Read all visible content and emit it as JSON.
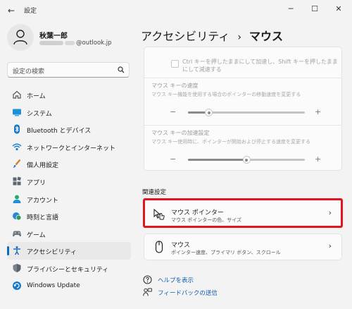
{
  "window": {
    "title": "設定",
    "back_glyph": "←",
    "minimize_glyph": "─",
    "maximize_glyph": "☐",
    "close_glyph": "✕"
  },
  "user": {
    "name": "秋葉一郎",
    "email_suffix": "@outlook.jp"
  },
  "search": {
    "placeholder": "設定の検索",
    "icon": "search-icon"
  },
  "nav": {
    "accent_color": "#0f6cbd",
    "items": [
      {
        "label": "ホーム",
        "icon": "home-icon"
      },
      {
        "label": "システム",
        "icon": "system-icon"
      },
      {
        "label": "Bluetooth とデバイス",
        "icon": "bluetooth-icon"
      },
      {
        "label": "ネットワークとインターネット",
        "icon": "network-icon"
      },
      {
        "label": "個人用設定",
        "icon": "brush-icon"
      },
      {
        "label": "アプリ",
        "icon": "apps-icon"
      },
      {
        "label": "アカウント",
        "icon": "account-icon"
      },
      {
        "label": "時刻と言語",
        "icon": "clock-globe-icon"
      },
      {
        "label": "ゲーム",
        "icon": "gamepad-icon"
      },
      {
        "label": "アクセシビリティ",
        "icon": "accessibility-icon",
        "active": true
      },
      {
        "label": "プライバシーとセキュリティ",
        "icon": "shield-icon"
      },
      {
        "label": "Windows Update",
        "icon": "update-icon"
      }
    ]
  },
  "breadcrumb": {
    "parent": "アクセシビリティ",
    "separator": "›",
    "current": "マウス"
  },
  "mouse_keys": {
    "checkbox_label": "Ctrl キーを押したままにして加速し、Shift キーを押したままにして減速する",
    "speed": {
      "title": "マウス キーの速度",
      "description": "マウス キー機能を使用する場合のポインターの移動速度を変更する",
      "minus": "−",
      "plus": "+",
      "value": 0.18
    },
    "acceleration": {
      "title": "マウス キーの加速設定",
      "description": "マウス キー使用時に、ポインターが開始および停止する速度を変更する",
      "minus": "−",
      "plus": "+",
      "value": 0.5
    }
  },
  "related": {
    "title": "関連設定",
    "items": [
      {
        "title": "マウス ポインター",
        "description": "マウス ポインターの色、サイズ",
        "icon": "mouse-pointer-icon",
        "chevron": "›",
        "highlighted": true,
        "highlight_color": "#e0161f"
      },
      {
        "title": "マウス",
        "description": "ポインター速度、プライマリ ボタン、スクロール",
        "icon": "mouse-icon",
        "chevron": "›"
      }
    ]
  },
  "links": {
    "help": "ヘルプを表示",
    "feedback": "フィードバックの送信"
  }
}
